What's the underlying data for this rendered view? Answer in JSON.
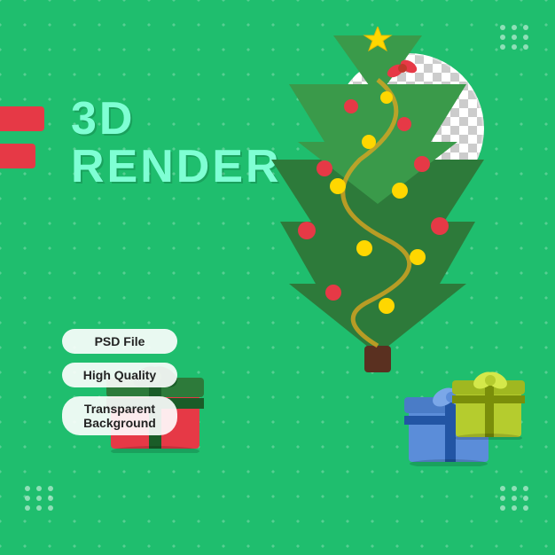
{
  "title": {
    "line1": "3D",
    "line2": "RENDER"
  },
  "badges": [
    {
      "id": "psd",
      "label": "PSD File"
    },
    {
      "id": "quality",
      "label": "High Quality"
    },
    {
      "id": "bg",
      "label": "Transparent\nBackground"
    }
  ],
  "colors": {
    "background": "#1fbe6e",
    "accent_red": "#e63946",
    "title_color": "#7fffd4",
    "badge_bg": "rgba(255,255,255,0.9)"
  },
  "decorations": {
    "dots_count": 9
  }
}
